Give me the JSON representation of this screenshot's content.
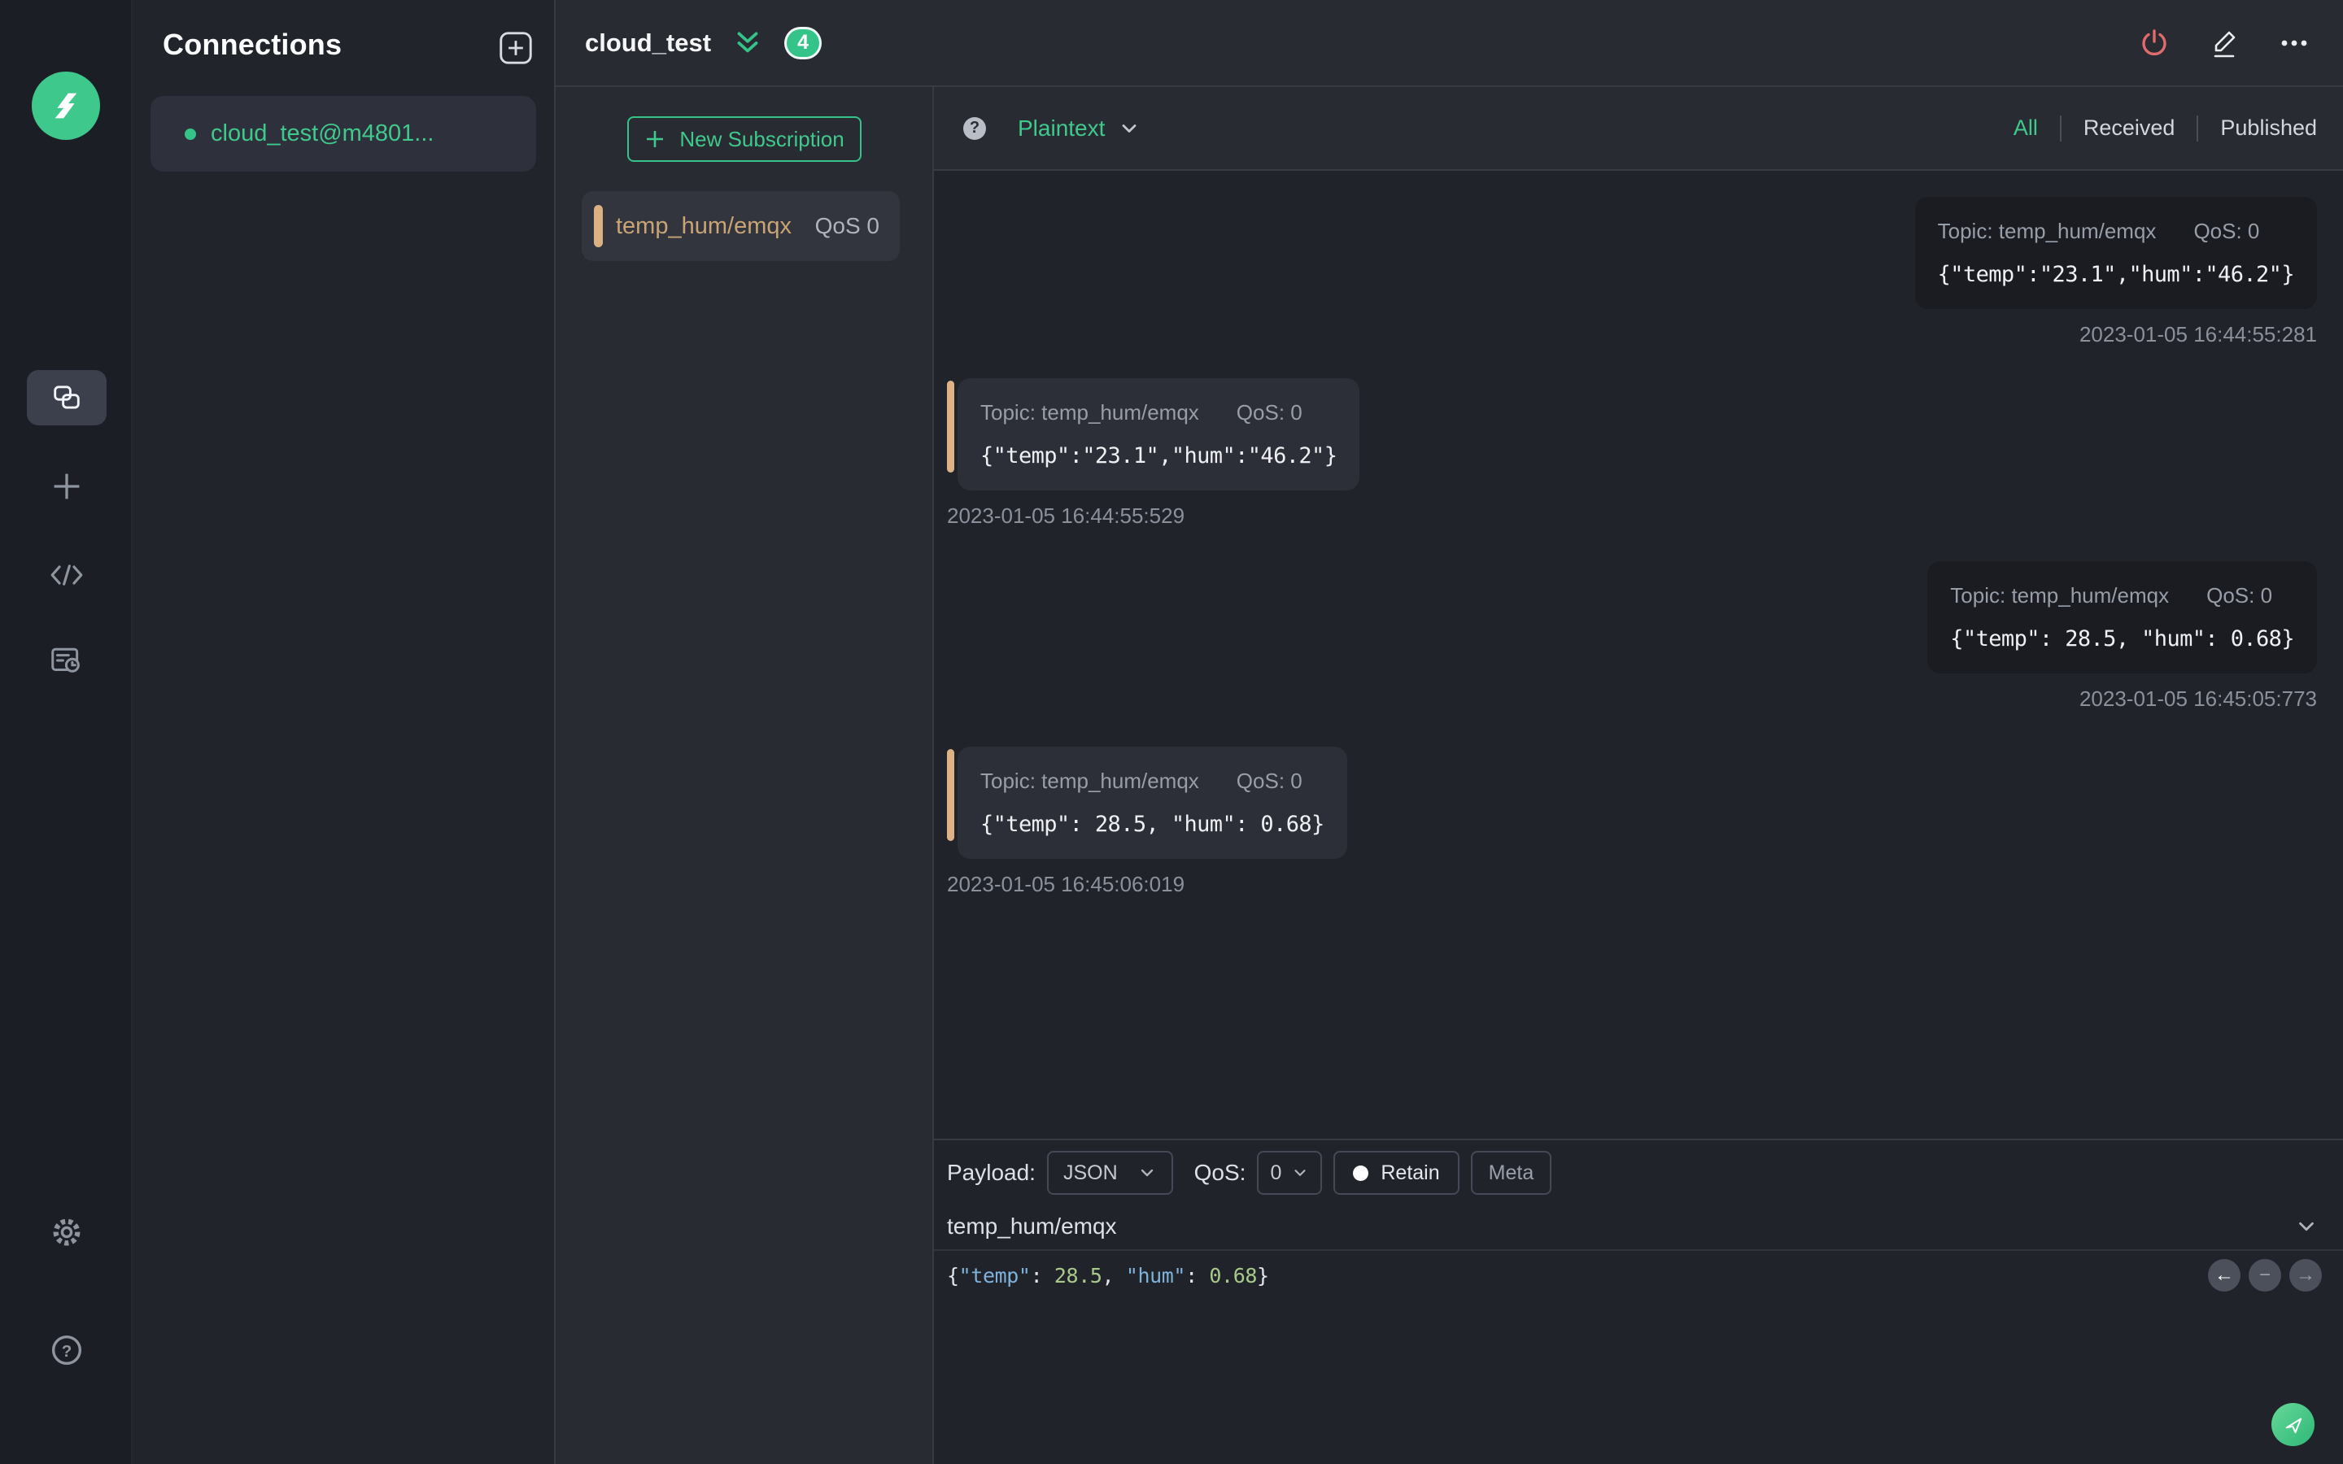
{
  "connections_panel": {
    "title": "Connections",
    "items": [
      {
        "name": "cloud_test@m4801...",
        "status": "connected"
      }
    ]
  },
  "header": {
    "title": "cloud_test",
    "unread_badge": "4"
  },
  "subscriptions": {
    "new_button_label": "New Subscription",
    "items": [
      {
        "topic": "temp_hum/emqx",
        "qos": "QoS 0"
      }
    ]
  },
  "toolbar": {
    "help_glyph": "?",
    "format": "Plaintext",
    "filters": [
      "All",
      "Received",
      "Published"
    ],
    "active_filter": "All"
  },
  "messages": [
    {
      "direction": "published",
      "topic_label": "Topic: temp_hum/emqx",
      "qos_label": "QoS: 0",
      "payload": "{\"temp\":\"23.1\",\"hum\":\"46.2\"}",
      "timestamp": "2023-01-05 16:44:55:281"
    },
    {
      "direction": "received",
      "topic_label": "Topic: temp_hum/emqx",
      "qos_label": "QoS: 0",
      "payload": "{\"temp\":\"23.1\",\"hum\":\"46.2\"}",
      "timestamp": "2023-01-05 16:44:55:529"
    },
    {
      "direction": "published",
      "topic_label": "Topic: temp_hum/emqx",
      "qos_label": "QoS: 0",
      "payload": "{\"temp\": 28.5, \"hum\": 0.68}",
      "timestamp": "2023-01-05 16:45:05:773"
    },
    {
      "direction": "received",
      "topic_label": "Topic: temp_hum/emqx",
      "qos_label": "QoS: 0",
      "payload": "{\"temp\": 28.5, \"hum\": 0.68}",
      "timestamp": "2023-01-05 16:45:06:019"
    }
  ],
  "publish": {
    "payload_label": "Payload:",
    "format_value": "JSON",
    "qos_label": "QoS:",
    "qos_value": "0",
    "retain_label": "Retain",
    "meta_label": "Meta",
    "topic_value": "temp_hum/emqx",
    "editor_tokens": {
      "p1": "{",
      "k1": "\"temp\"",
      "p2": ": ",
      "n1": "28.5",
      "p3": ", ",
      "k2": "\"hum\"",
      "p4": ": ",
      "n2": "0.68",
      "p5": "}"
    },
    "history": {
      "prev_glyph": "←",
      "remove_glyph": "−",
      "next_glyph": "→"
    }
  },
  "colors": {
    "accent_green": "#34c388",
    "topic_tan": "#dab183",
    "danger_red": "#e16a6a"
  }
}
